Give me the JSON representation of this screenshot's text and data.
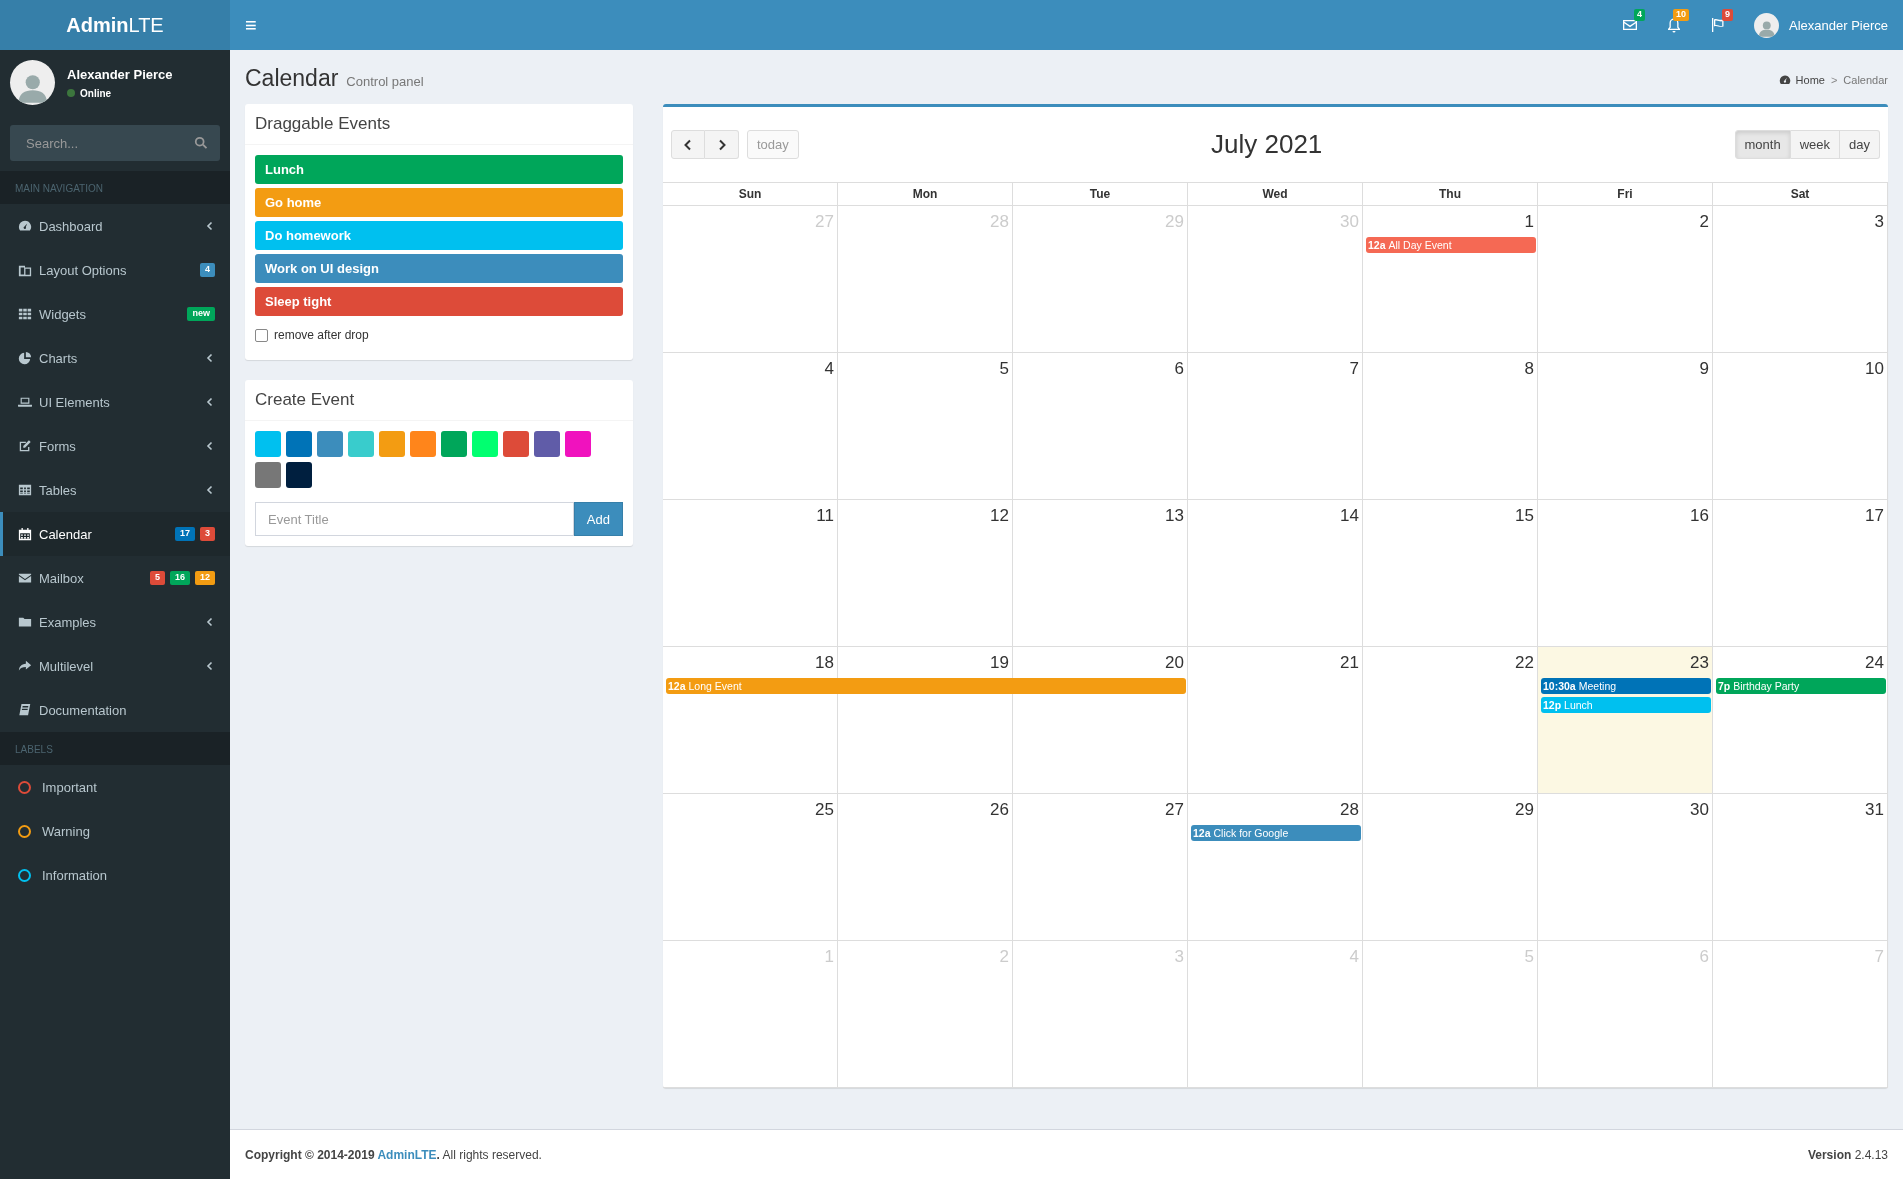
{
  "brand": "**Admin**LTE",
  "user_panel": {
    "name": "Alexander Pierce",
    "status": "Online"
  },
  "search": {
    "placeholder": "Search..."
  },
  "sidebar": {
    "header": "MAIN NAVIGATION",
    "items": [
      {
        "label": "Dashboard",
        "caret": true,
        "selected": false
      },
      {
        "label": "Layout Options",
        "caret": false,
        "selected": false,
        "badges": [
          {
            "text": "4",
            "color": "#3c8dbc"
          }
        ]
      },
      {
        "label": "Widgets",
        "caret": false,
        "selected": false,
        "badges": [
          {
            "text": "new",
            "color": "#00a65a"
          }
        ]
      },
      {
        "label": "Charts",
        "caret": true,
        "selected": false
      },
      {
        "label": "UI Elements",
        "caret": true,
        "selected": false
      },
      {
        "label": "Forms",
        "caret": true,
        "selected": false
      },
      {
        "label": "Tables",
        "caret": true,
        "selected": false
      },
      {
        "label": "Calendar",
        "caret": false,
        "selected": true,
        "badges": [
          {
            "text": "17",
            "color": "#0073b7"
          },
          {
            "text": "3",
            "color": "#dd4b39"
          }
        ]
      },
      {
        "label": "Mailbox",
        "caret": false,
        "selected": false,
        "badges": [
          {
            "text": "5",
            "color": "#dd4b39"
          },
          {
            "text": "16",
            "color": "#00a65a"
          },
          {
            "text": "12",
            "color": "#f39c12"
          }
        ]
      },
      {
        "label": "Examples",
        "caret": true,
        "selected": false
      },
      {
        "label": "Multilevel",
        "caret": true,
        "selected": false
      },
      {
        "label": "Documentation",
        "caret": false,
        "selected": false
      }
    ],
    "labels_header": "LABELS",
    "labels": [
      {
        "label": "Important",
        "color": "#dd4b39"
      },
      {
        "label": "Warning",
        "color": "#f39c12"
      },
      {
        "label": "Information",
        "color": "#00c0ef"
      }
    ]
  },
  "navbar": {
    "menu": "≡",
    "notifications": [
      {
        "kind": "messages",
        "count": "4",
        "color": "#00a65a"
      },
      {
        "kind": "alerts",
        "count": "10",
        "color": "#f39c12"
      },
      {
        "kind": "tasks",
        "count": "9",
        "color": "#dd4b39"
      }
    ],
    "user": "Alexander Pierce"
  },
  "content_header": {
    "title": "Calendar",
    "subtitle": "Control panel",
    "breadcrumb": [
      "Home",
      "Calendar"
    ],
    "separator": ">"
  },
  "draggable_events": {
    "title": "Draggable Events",
    "events": [
      {
        "label": "Lunch",
        "color": "#00a65a"
      },
      {
        "label": "Go home",
        "color": "#f39c12"
      },
      {
        "label": "Do homework",
        "color": "#00c0ef"
      },
      {
        "label": "Work on UI design",
        "color": "#3c8dbc"
      },
      {
        "label": "Sleep tight",
        "color": "#dd4b39"
      }
    ],
    "remove_after_drop": {
      "label": "remove after drop",
      "checked": false
    }
  },
  "create_event": {
    "title": "Create Event",
    "colors": [
      {
        "color": "#00c0ef"
      },
      {
        "color": "#0073b7"
      },
      {
        "color": "#3c8dbc"
      },
      {
        "color": "#39cccc"
      },
      {
        "color": "#f39c12"
      },
      {
        "color": "#ff851b"
      },
      {
        "color": "#00a65a"
      },
      {
        "color": "#01ff70"
      },
      {
        "color": "#dd4b39"
      },
      {
        "color": "#605ca8"
      },
      {
        "color": "#f012be"
      },
      {
        "color": "#777777"
      },
      {
        "color": "#001f3f"
      }
    ],
    "input": {
      "placeholder": "Event Title"
    },
    "button": "Add"
  },
  "calendar": {
    "title": "July 2021",
    "today_button": "today",
    "views": [
      {
        "label": "month",
        "selected": true
      },
      {
        "label": "week",
        "selected": false
      },
      {
        "label": "day",
        "selected": false
      }
    ],
    "weekdays": [
      "Sun",
      "Mon",
      "Tue",
      "Wed",
      "Thu",
      "Fri",
      "Sat"
    ],
    "weeks": [
      {
        "days": [
          {
            "date": "27",
            "other_month": true,
            "today": false,
            "continuation": false
          },
          {
            "date": "28",
            "other_month": true,
            "today": false,
            "continuation": false
          },
          {
            "date": "29",
            "other_month": true,
            "today": false,
            "continuation": false
          },
          {
            "date": "30",
            "other_month": true,
            "today": false,
            "continuation": false
          },
          {
            "date": "1",
            "other_month": false,
            "today": false,
            "continuation": false,
            "events": [
              {
                "time": "12a",
                "title": "All Day Event",
                "color": "#f56954"
              }
            ]
          },
          {
            "date": "2",
            "other_month": false,
            "today": false,
            "continuation": false
          },
          {
            "date": "3",
            "other_month": false,
            "today": false,
            "continuation": false
          }
        ]
      },
      {
        "days": [
          {
            "date": "4",
            "other_month": false,
            "today": false,
            "continuation": false
          },
          {
            "date": "5",
            "other_month": false,
            "today": false,
            "continuation": false
          },
          {
            "date": "6",
            "other_month": false,
            "today": false,
            "continuation": false
          },
          {
            "date": "7",
            "other_month": false,
            "today": false,
            "continuation": false
          },
          {
            "date": "8",
            "other_month": false,
            "today": false,
            "continuation": false
          },
          {
            "date": "9",
            "other_month": false,
            "today": false,
            "continuation": false
          },
          {
            "date": "10",
            "other_month": false,
            "today": false,
            "continuation": false
          }
        ]
      },
      {
        "days": [
          {
            "date": "11",
            "other_month": false,
            "today": false,
            "continuation": false
          },
          {
            "date": "12",
            "other_month": false,
            "today": false,
            "continuation": false
          },
          {
            "date": "13",
            "other_month": false,
            "today": false,
            "continuation": false
          },
          {
            "date": "14",
            "other_month": false,
            "today": false,
            "continuation": false
          },
          {
            "date": "15",
            "other_month": false,
            "today": false,
            "continuation": false
          },
          {
            "date": "16",
            "other_month": false,
            "today": false,
            "continuation": false
          },
          {
            "date": "17",
            "other_month": false,
            "today": false,
            "continuation": false
          }
        ]
      },
      {
        "days": [
          {
            "date": "18",
            "other_month": false,
            "today": false,
            "continuation": false,
            "events": [
              {
                "time": "12a",
                "title": "Long Event",
                "color": "#f39c12"
              }
            ]
          },
          {
            "date": "19",
            "other_month": false,
            "today": false,
            "continuation": true
          },
          {
            "date": "20",
            "other_month": false,
            "today": false,
            "continuation": true
          },
          {
            "date": "21",
            "other_month": false,
            "today": false,
            "continuation": false
          },
          {
            "date": "22",
            "other_month": false,
            "today": false,
            "continuation": false
          },
          {
            "date": "23",
            "other_month": false,
            "today": true,
            "continuation": false,
            "events": [
              {
                "time": "10:30a",
                "title": "Meeting",
                "color": "#0073b7"
              },
              {
                "time": "12p",
                "title": "Lunch",
                "color": "#00c0ef"
              }
            ]
          },
          {
            "date": "24",
            "other_month": false,
            "today": false,
            "continuation": false,
            "events": [
              {
                "time": "7p",
                "title": "Birthday Party",
                "color": "#00a65a"
              }
            ]
          }
        ]
      },
      {
        "days": [
          {
            "date": "25",
            "other_month": false,
            "today": false,
            "continuation": false
          },
          {
            "date": "26",
            "other_month": false,
            "today": false,
            "continuation": false
          },
          {
            "date": "27",
            "other_month": false,
            "today": false,
            "continuation": false
          },
          {
            "date": "28",
            "other_month": false,
            "today": false,
            "continuation": false,
            "events": [
              {
                "time": "12a",
                "title": "Click for Google",
                "color": "#3c8dbc"
              }
            ]
          },
          {
            "date": "29",
            "other_month": false,
            "today": false,
            "continuation": false
          },
          {
            "date": "30",
            "other_month": false,
            "today": false,
            "continuation": false
          },
          {
            "date": "31",
            "other_month": false,
            "today": false,
            "continuation": false
          }
        ]
      },
      {
        "days": [
          {
            "date": "1",
            "other_month": true,
            "today": false,
            "continuation": false
          },
          {
            "date": "2",
            "other_month": true,
            "today": false,
            "continuation": false
          },
          {
            "date": "3",
            "other_month": true,
            "today": false,
            "continuation": false
          },
          {
            "date": "4",
            "other_month": true,
            "today": false,
            "continuation": false
          },
          {
            "date": "5",
            "other_month": true,
            "today": false,
            "continuation": false
          },
          {
            "date": "6",
            "other_month": true,
            "today": false,
            "continuation": false
          },
          {
            "date": "7",
            "other_month": true,
            "today": false,
            "continuation": false
          }
        ]
      }
    ]
  },
  "footer": {
    "copyright": "Copyright © 2014-2019",
    "link": "AdminLTE",
    "rest": "**.** All rights reserved.",
    "version": "**Version** 2.4.13"
  }
}
